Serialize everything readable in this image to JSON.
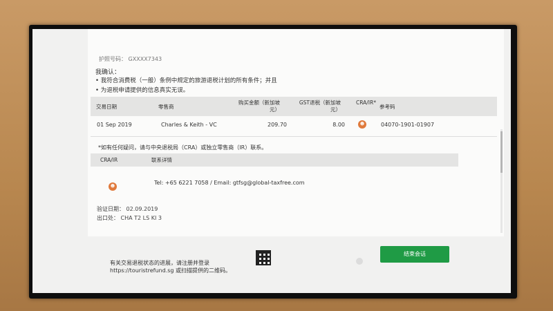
{
  "header": {
    "passport_label": "护照号码：",
    "passport_value": "GXXXX7343"
  },
  "confirmation": {
    "title": "我确认：",
    "bullets": [
      "• 我符合消费税（一般）条例中规定的旅游退税计划的所有条件；并且",
      "• 为退税申请提供的信息真实无误。"
    ]
  },
  "transactions": {
    "headers": {
      "date": "交易日期",
      "retailer": "零售商",
      "amount": "购买金额（新加坡元）",
      "gst": "GST退税（新加坡元）",
      "cra_ir": "CRA/IR*",
      "reference": "参考码"
    },
    "rows": [
      {
        "date": "01 Sep 2019",
        "retailer": "Charles & Keith - VC",
        "amount": "209.70",
        "gst": "8.00",
        "reference": "04070-1901-01907"
      }
    ]
  },
  "note": "*如有任何疑问，请与中央退税局（CRA）或独立零售商（IR）联系。",
  "contact": {
    "col1": "CRA/IR",
    "col2": "联系详情",
    "details": "Tel: +65 6221 7058 / Email: gtfsg@global-taxfree.com"
  },
  "verification": {
    "date_label": "验证日期：",
    "date_value": "02.09.2019",
    "exit_label": "出口处：",
    "exit_value": "CHA T2 LS KI 3"
  },
  "footer": {
    "text": "有关交易退税状态的进展，请注册并登录 https://touristrefund.sg 或扫描提供的二维码。",
    "end_button": "结束会话"
  },
  "colors": {
    "accent_button": "#1f9b45",
    "cra_icon": "#e07a3c"
  }
}
